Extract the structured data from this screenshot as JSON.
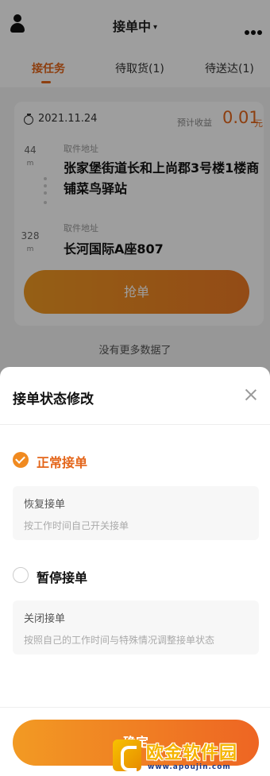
{
  "header": {
    "title": "接单中",
    "caret": "▾"
  },
  "tabs": [
    {
      "label": "接任务",
      "active": true
    },
    {
      "label": "待取货(1)",
      "active": false
    },
    {
      "label": "待送达(1)",
      "active": false
    }
  ],
  "order": {
    "date": "2021.11.24",
    "income_label": "预计收益",
    "income_value": "0.01",
    "income_unit": "元",
    "pickup": {
      "distance": "44",
      "distance_unit": "m",
      "label": "取件地址",
      "address": "张家堡街道长和上尚郡3号楼1楼商铺菜鸟驿站"
    },
    "delivery": {
      "distance": "328",
      "distance_unit": "m",
      "label": "取件地址",
      "address": "长河国际A座807"
    },
    "grab_label": "抢单"
  },
  "no_more_text": "没有更多数据了",
  "sheet": {
    "title": "接单状态修改",
    "options": [
      {
        "title": "正常接单",
        "checked": true,
        "info_title": "恢复接单",
        "info_desc": "按工作时间自己开关接单"
      },
      {
        "title": "暂停接单",
        "checked": false,
        "info_title": "关闭接单",
        "info_desc": "按照自己的工作时间与特殊情况调整接单状态"
      }
    ],
    "confirm_label": "确定"
  },
  "watermark": {
    "text": "欧金软件园",
    "url": "www.apoujin.com"
  },
  "colors": {
    "accent": "#e4661b",
    "button_start": "#f29a23",
    "button_end": "#ee6523"
  },
  "icons": [
    "avatar-icon",
    "more-icon",
    "timer-icon",
    "close-icon",
    "check-icon"
  ]
}
